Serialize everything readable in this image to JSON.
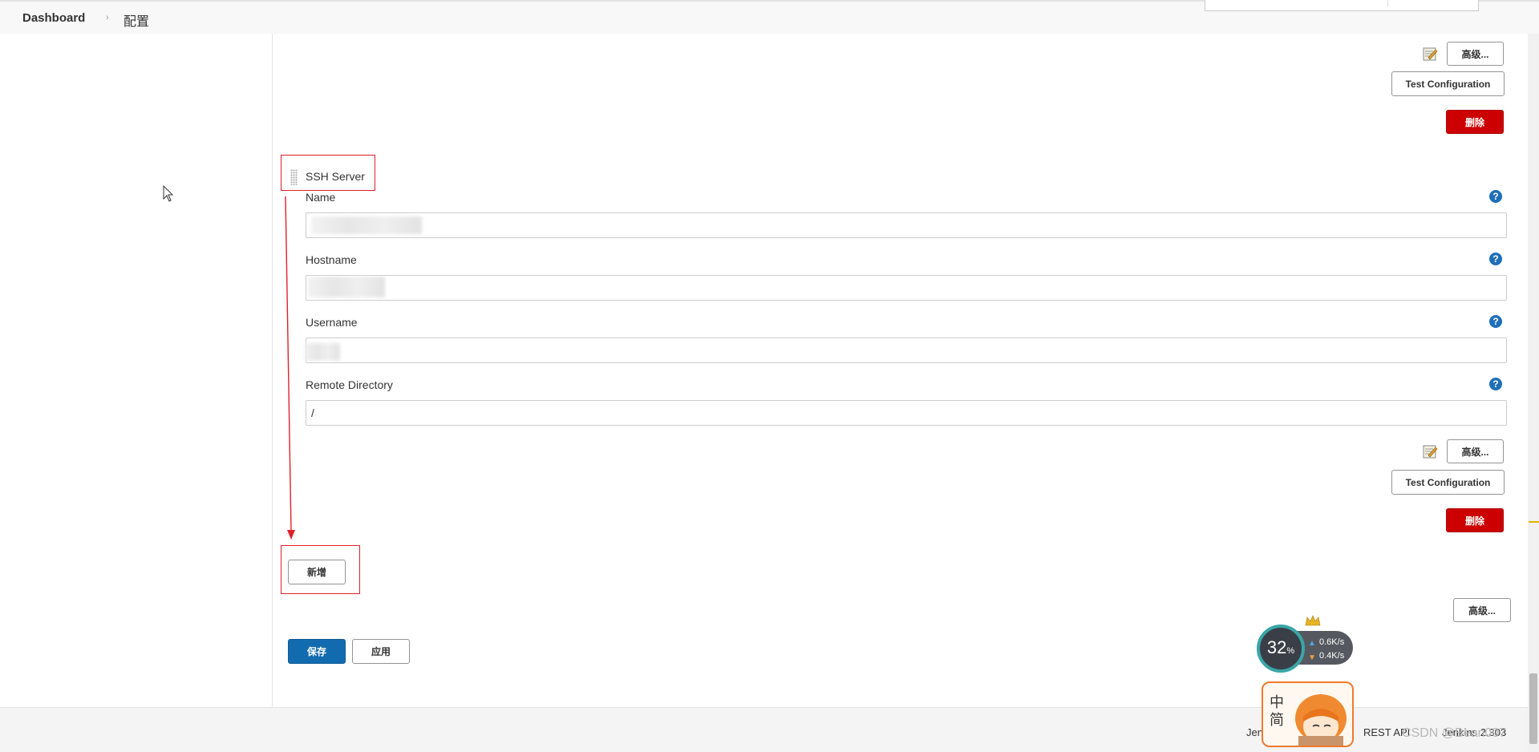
{
  "breadcrumb": {
    "home": "Dashboard",
    "separator": "›",
    "current": "配置"
  },
  "top_section": {
    "advanced_button": "高级...",
    "test_button": "Test Configuration",
    "delete_button": "删除"
  },
  "ssh_server": {
    "title": "SSH Server",
    "fields": [
      {
        "label": "Name",
        "value": ""
      },
      {
        "label": "Hostname",
        "value": ""
      },
      {
        "label": "Username",
        "value": ""
      },
      {
        "label": "Remote Directory",
        "value": "/"
      }
    ],
    "help_glyph": "?",
    "advanced_button": "高级...",
    "test_button": "Test Configuration",
    "delete_button": "删除"
  },
  "add_button": "新增",
  "global_advanced_button": "高级...",
  "form_actions": {
    "save": "保存",
    "apply": "应用"
  },
  "footer": {
    "jenkins_link": "Jen",
    "rest_api": "REST API",
    "version": "Jenkins 2.303"
  },
  "watermark": "CSDN @Bean007",
  "net_monitor": {
    "cpu_percent": "32",
    "percent_sign": "%",
    "upload": "0.6",
    "download": "0.4",
    "unit": "K/s"
  },
  "ime": {
    "chars": [
      "中",
      "简"
    ]
  },
  "colors": {
    "delete": "#cc0000",
    "save": "#136baf",
    "help": "#1e6fb8",
    "annotation": "#e0202a"
  }
}
